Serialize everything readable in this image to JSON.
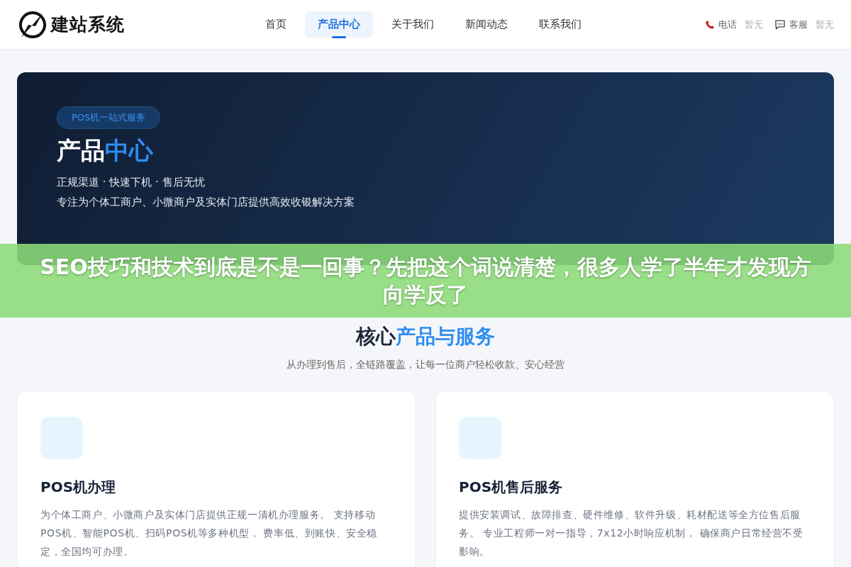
{
  "header": {
    "logo_text": "建站系统",
    "nav": [
      {
        "label": "首页",
        "selected": false
      },
      {
        "label": "产品中心",
        "selected": true
      },
      {
        "label": "关于我们",
        "selected": false
      },
      {
        "label": "新闻动态",
        "selected": false
      },
      {
        "label": "联系我们",
        "selected": false
      }
    ],
    "contacts": [
      {
        "kind": "phone",
        "label": "电话",
        "value": "暂无"
      },
      {
        "kind": "chat",
        "label": "客服",
        "value": "暂无"
      }
    ]
  },
  "hero": {
    "badge": "POS机一站式服务",
    "title_plain": "产品",
    "title_accent": "中心",
    "tagline": "正规渠道 · 快速下机 · 售后无忧",
    "description": "专注为个体工商户、小微商户及实体门店提供高效收银解决方案"
  },
  "overlay_banner": {
    "text": "SEO技巧和技术到底是不是一回事？先把这个词说清楚，很多人学了半年才发现方向学反了"
  },
  "section": {
    "title_plain": "核心",
    "title_accent": "产品与服务",
    "subtitle": "从办理到售后，全链路覆盖，让每一位商户轻松收款、安心经营"
  },
  "cards": [
    {
      "title": "POS机办理",
      "description": "为个体工商户、小微商户及实体门店提供正规一清机办理服务。 支持移动POS机、智能POS机、扫码POS机等多种机型， 费率低、到账快、安全稳定，全国均可办理。"
    },
    {
      "title": "POS机售后服务",
      "description": "提供安装调试、故障排查、硬件维修、软件升级、耗材配送等全方位售后服务。 专业工程师一对一指导，7x12小时响应机制， 确保商户日常经营不受影响。"
    }
  ]
}
